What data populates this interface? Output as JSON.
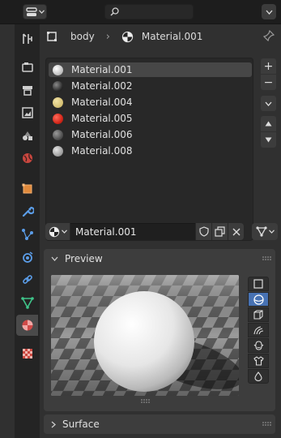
{
  "header": {
    "search_placeholder": ""
  },
  "breadcrumb": {
    "object": "body",
    "material": "Material.001"
  },
  "material_slots": [
    {
      "label": "Material.001",
      "color": "#e8e8e8",
      "selected": true
    },
    {
      "label": "Material.002",
      "color": "#2f2f2f",
      "selected": false
    },
    {
      "label": "Material.004",
      "color": "#d8c77a",
      "selected": false
    },
    {
      "label": "Material.005",
      "color": "#d4271a",
      "selected": false
    },
    {
      "label": "Material.006",
      "color": "#4e4e4e",
      "selected": false
    },
    {
      "label": "Material.008",
      "color": "#a8a8a8",
      "selected": false
    }
  ],
  "material_selector": {
    "name": "Material.001"
  },
  "panels": {
    "preview_label": "Preview",
    "surface_label": "Surface"
  },
  "preview_shapes": [
    "flat-icon",
    "sphere-icon",
    "cube-icon",
    "hair-icon",
    "monkey-icon",
    "cloth-icon",
    "fluid-icon"
  ],
  "properties_tabs": [
    "tool-icon",
    "render-icon",
    "output-icon",
    "view-layer-icon",
    "scene-icon",
    "world-icon",
    "object-icon",
    "modifier-icon",
    "particles-icon",
    "physics-icon",
    "constraints-icon",
    "data-icon",
    "material-icon",
    "texture-icon"
  ],
  "colors": {
    "accent": "#4772b3",
    "panel": "#3d3d3d",
    "background": "#303030"
  }
}
